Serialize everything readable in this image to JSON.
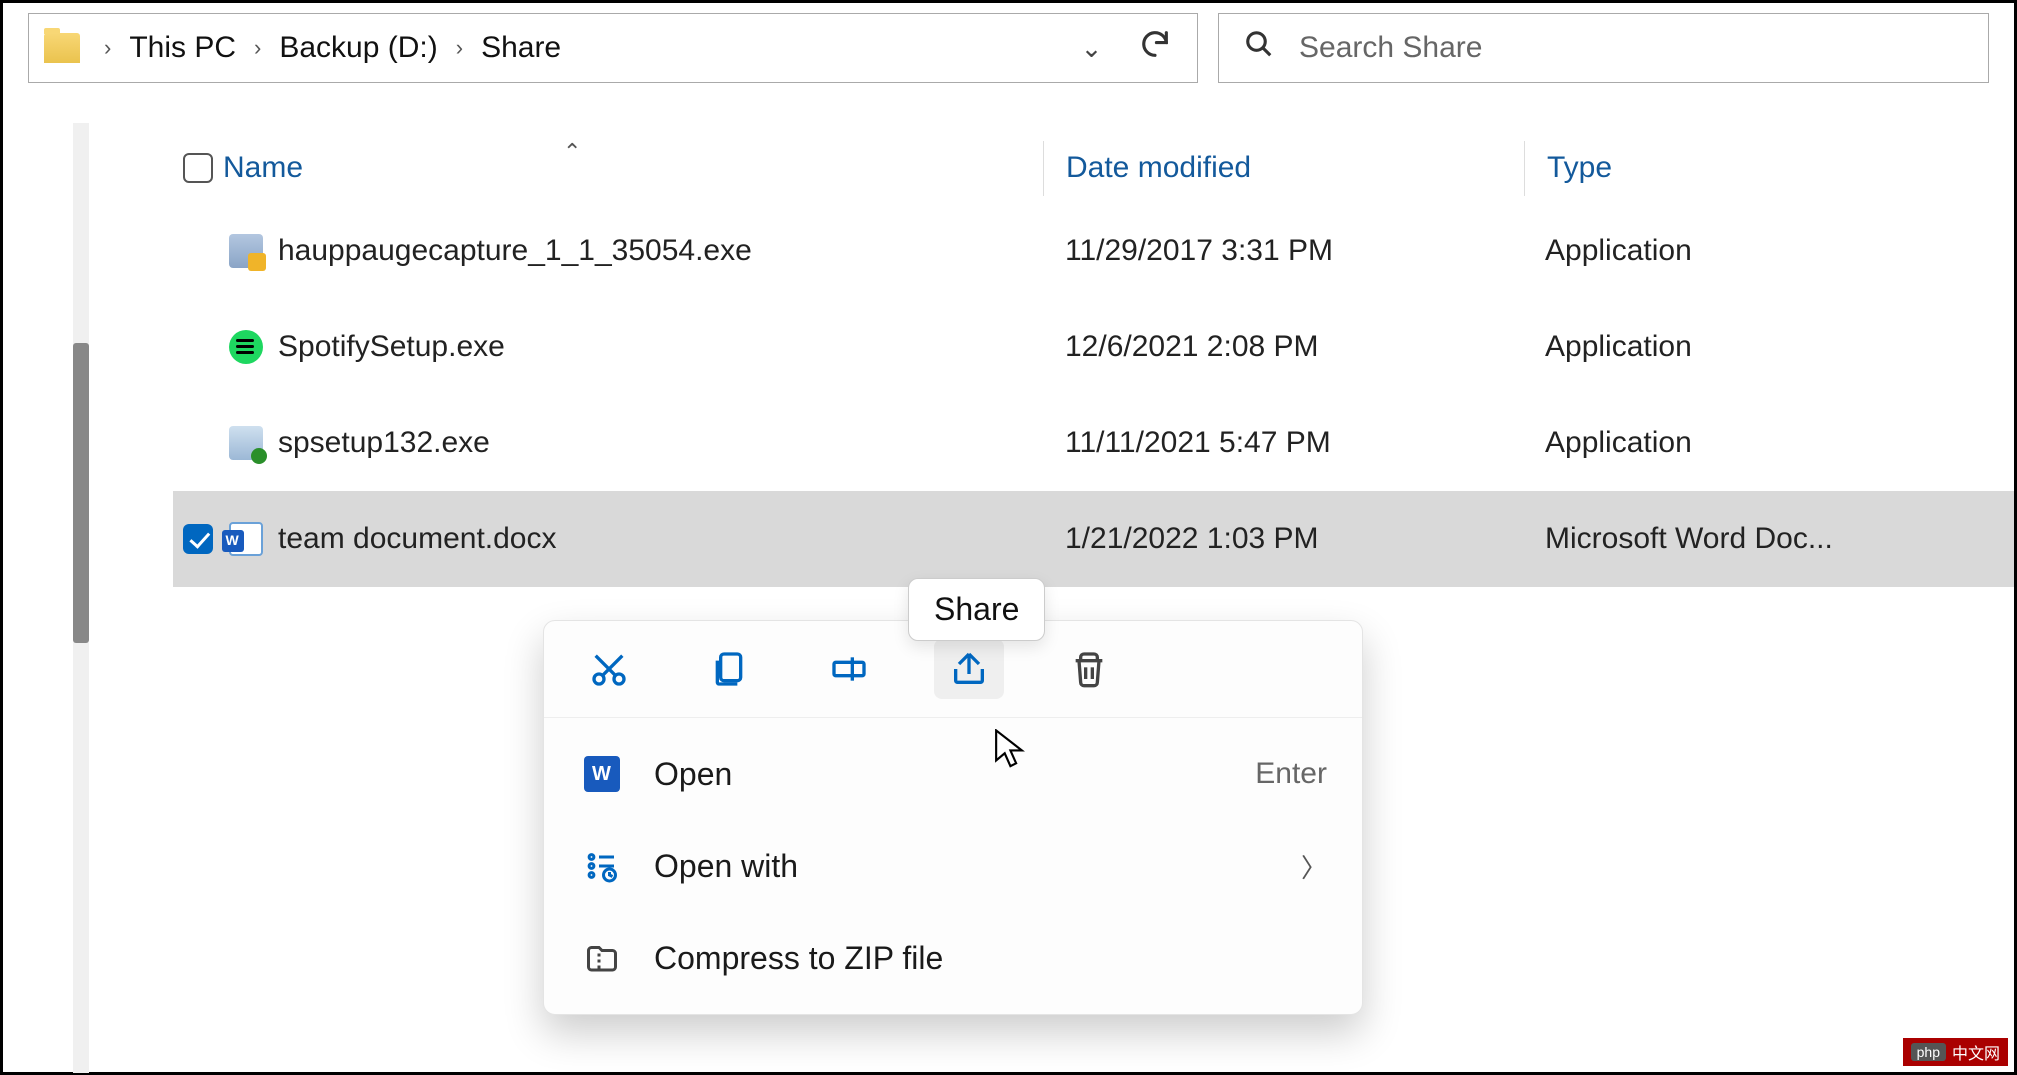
{
  "breadcrumb": {
    "b0": "This PC",
    "b1": "Backup (D:)",
    "b2": "Share"
  },
  "search": {
    "placeholder": "Search Share"
  },
  "columns": {
    "name": "Name",
    "date": "Date modified",
    "type": "Type"
  },
  "files": [
    {
      "name": "hauppaugecapture_1_1_35054.exe",
      "date": "11/29/2017 3:31 PM",
      "type": "Application"
    },
    {
      "name": "SpotifySetup.exe",
      "date": "12/6/2021 2:08 PM",
      "type": "Application"
    },
    {
      "name": "spsetup132.exe",
      "date": "11/11/2021 5:47 PM",
      "type": "Application"
    },
    {
      "name": "team document.docx",
      "date": "1/21/2022 1:03 PM",
      "type": "Microsoft Word Doc..."
    }
  ],
  "tooltip": "Share",
  "context_menu": {
    "open": "Open",
    "open_shortcut": "Enter",
    "open_with": "Open with",
    "compress": "Compress to ZIP file"
  },
  "watermark": "中文网"
}
